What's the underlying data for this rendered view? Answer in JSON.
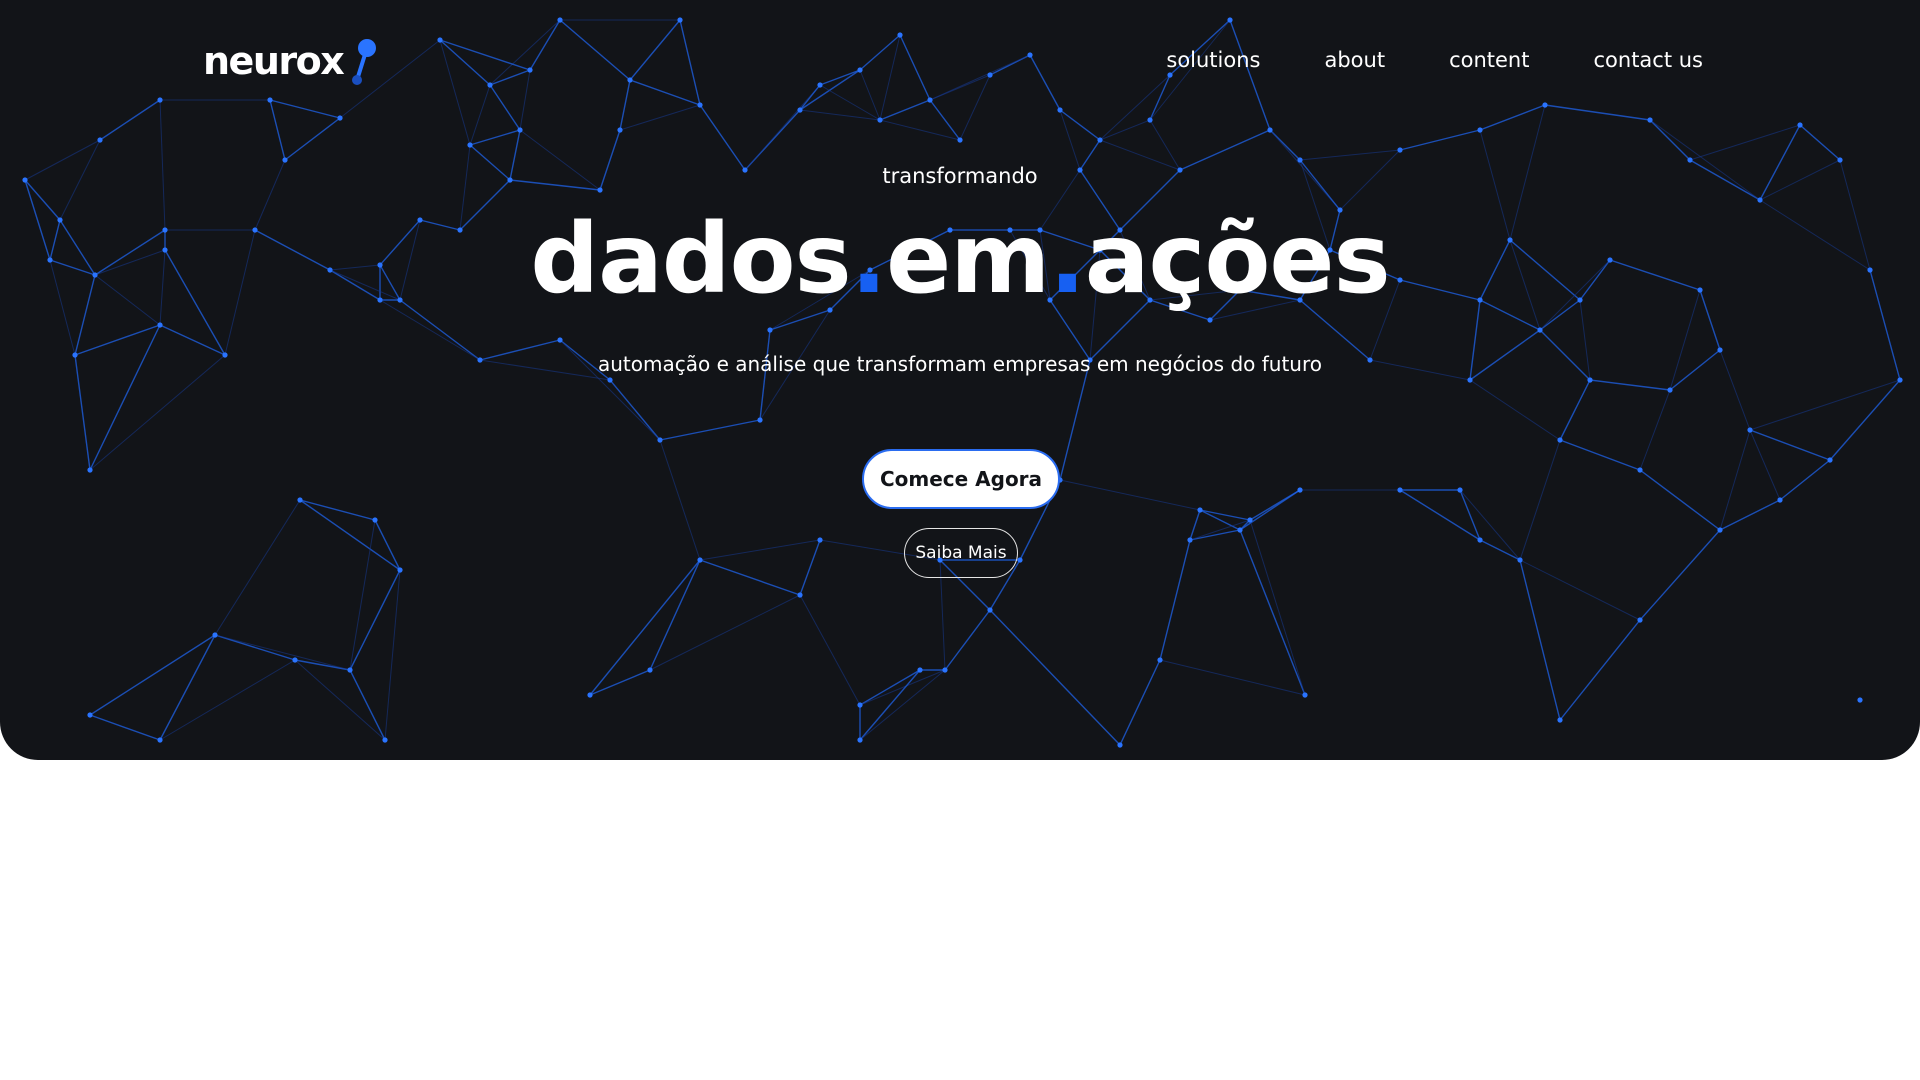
{
  "brand": {
    "name": "neurox",
    "accent_color": "#1760f2",
    "background_color": "#121418",
    "logo_icon": "connected-nodes-icon"
  },
  "nav": {
    "items": [
      {
        "label": "solutions"
      },
      {
        "label": "about"
      },
      {
        "label": "content"
      },
      {
        "label": "contact us"
      }
    ]
  },
  "hero": {
    "eyebrow": "transformando",
    "headline": {
      "word1": "dados",
      "separator": ".",
      "word2": "em",
      "word3": "ações"
    },
    "subtitle": "automação e análise que transformam empresas em negócios do futuro",
    "primary_cta": "Comece Agora",
    "secondary_cta": "Saiba Mais",
    "background_decoration": "network-graph"
  }
}
